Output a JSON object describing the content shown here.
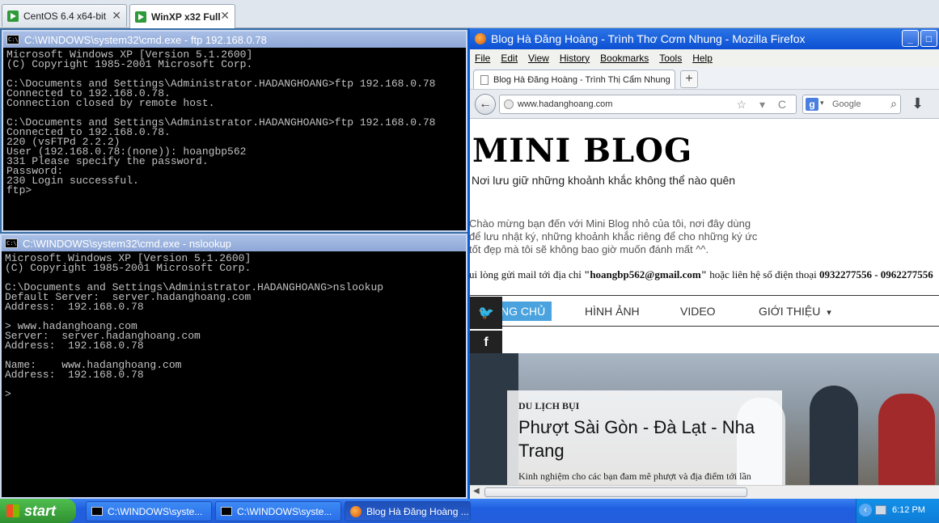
{
  "vm_tabs": [
    {
      "label": "CentOS 6.4 x64-bit",
      "close": "✕"
    },
    {
      "label": "WinXP x32 Full",
      "close": "✕"
    }
  ],
  "cmd_ftp": {
    "title": "C:\\WINDOWS\\system32\\cmd.exe - ftp 192.168.0.78",
    "icon_text": "C:\\",
    "lines": "Microsoft Windows XP [Version 5.1.2600]\n(C) Copyright 1985-2001 Microsoft Corp.\n\nC:\\Documents and Settings\\Administrator.HADANGHOANG>ftp 192.168.0.78\nConnected to 192.168.0.78.\nConnection closed by remote host.\n\nC:\\Documents and Settings\\Administrator.HADANGHOANG>ftp 192.168.0.78\nConnected to 192.168.0.78.\n220 (vsFTPd 2.2.2)\nUser (192.168.0.78:(none)): hoangbp562\n331 Please specify the password.\nPassword:\n230 Login successful.\nftp>"
  },
  "cmd_ns": {
    "title": "C:\\WINDOWS\\system32\\cmd.exe - nslookup",
    "icon_text": "C:\\",
    "lines": "Microsoft Windows XP [Version 5.1.2600]\n(C) Copyright 1985-2001 Microsoft Corp.\n\nC:\\Documents and Settings\\Administrator.HADANGHOANG>nslookup\nDefault Server:  server.hadanghoang.com\nAddress:  192.168.0.78\n\n> www.hadanghoang.com\nServer:  server.hadanghoang.com\nAddress:  192.168.0.78\n\nName:    www.hadanghoang.com\nAddress:  192.168.0.78\n\n>"
  },
  "firefox": {
    "title": "Blog Hà Đăng Hoàng - Trình Thơ Cơm Nhung - Mozilla Firefox",
    "min": "_",
    "max": "□",
    "menu": [
      "File",
      "Edit",
      "View",
      "History",
      "Bookmarks",
      "Tools",
      "Help"
    ],
    "tab_label": "Blog Hà Đăng Hoàng - Trình Thị Cẩm Nhung",
    "new_tab": "+",
    "back": "←",
    "url": "www.hadanghoang.com",
    "url_icons": "☆ ▾ C",
    "search_engine": "g",
    "search_caret": "▾",
    "search_placeholder": "Google",
    "search_icon": "⌕",
    "download_icon": "⬇"
  },
  "blog": {
    "title": "MINI BLOG",
    "tagline": "Nơi lưu giữ những khoảnh khắc không thể nào quên",
    "intro": "Chào mừng bạn đến với Mini Blog nhỏ của tôi, nơi đây dùng để lưu nhật ký, những khoảnh khắc riêng để cho những ký ức tốt đẹp mà tôi sẽ không bao giờ muốn đánh mất ^^.",
    "contact_pre": "ui lòng gửi mail tới địa chỉ ",
    "contact_email": "\"hoangbp562@gmail.com\"",
    "contact_mid": " hoặc liên hệ số điện thoại ",
    "contact_phone": "0932277556 - 0962277556",
    "nav": {
      "home": "NG CHỦ",
      "images": "HÌNH ẢNH",
      "video": "VIDEO",
      "about": "GIỚI THIỆU",
      "about_caret": "▾"
    },
    "social": {
      "twitter": "🐦",
      "facebook": "f"
    },
    "featured": {
      "category": "DU LỊCH BỤI",
      "headline": "Phượt Sài Gòn - Đà Lạt - Nha Trang",
      "excerpt": "Kinh nghiệm cho các bạn đam mê phượt và địa điểm tới lần"
    },
    "scroll_left": "◀"
  },
  "taskbar": {
    "start": "start",
    "buttons": [
      {
        "label": "C:\\WINDOWS\\syste..."
      },
      {
        "label": "C:\\WINDOWS\\syste..."
      },
      {
        "label": "Blog Hà Đăng Hoàng ..."
      }
    ],
    "tray_chevron": "‹",
    "clock": "6:12 PM"
  }
}
